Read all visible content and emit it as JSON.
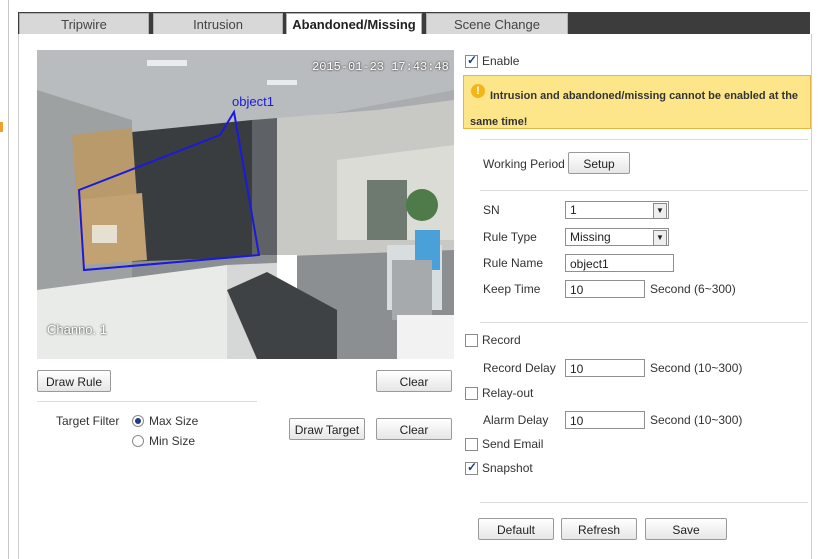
{
  "tabs": [
    {
      "label": "Tripwire"
    },
    {
      "label": "Intrusion"
    },
    {
      "label": "Abandoned/Missing",
      "active": true
    },
    {
      "label": "Scene Change"
    }
  ],
  "video": {
    "timestamp": "2015-01-23 17:43:48",
    "channel": "Channo. 1",
    "object_label": "object1"
  },
  "left_controls": {
    "draw_rule": "Draw Rule",
    "clear_1": "Clear",
    "target_filter_label": "Target Filter",
    "max_size": "Max Size",
    "min_size": "Min Size",
    "draw_target": "Draw Target",
    "clear_2": "Clear"
  },
  "settings": {
    "enable_label": "Enable",
    "enable_checked": true,
    "warning": "Intrusion and abandoned/missing cannot be enabled at the same time!",
    "working_period_label": "Working Period",
    "setup_button": "Setup",
    "sn_label": "SN",
    "sn_value": "1",
    "rule_type_label": "Rule Type",
    "rule_type_value": "Missing",
    "rule_name_label": "Rule Name",
    "rule_name_value": "object1",
    "keep_time_label": "Keep Time",
    "keep_time_value": "10",
    "keep_time_unit": "Second (6~300)",
    "record_label": "Record",
    "record_checked": false,
    "record_delay_label": "Record Delay",
    "record_delay_value": "10",
    "record_delay_unit": "Second (10~300)",
    "relay_out_label": "Relay-out",
    "relay_out_checked": false,
    "alarm_delay_label": "Alarm Delay",
    "alarm_delay_value": "10",
    "alarm_delay_unit": "Second (10~300)",
    "send_email_label": "Send Email",
    "send_email_checked": false,
    "snapshot_label": "Snapshot",
    "snapshot_checked": true
  },
  "footer": {
    "default": "Default",
    "refresh": "Refresh",
    "save": "Save"
  },
  "colors": {
    "tabbar": "#3c3c3c",
    "warning_bg": "#fde68a",
    "rule_line": "#1a1adc",
    "checkmark": "#1a3c8a"
  }
}
